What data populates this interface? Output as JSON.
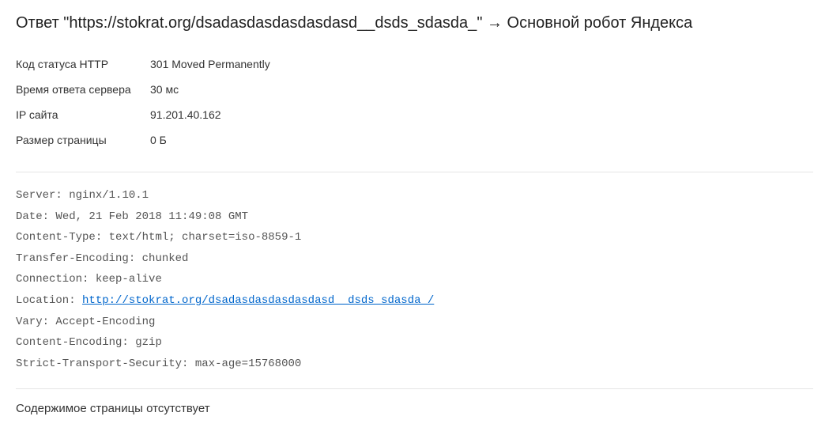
{
  "title": {
    "prefix": "Ответ \"",
    "url": "https://stokrat.org/dsadasdasdasdasdasd__dsds_sdasda_",
    "suffix": "\" → Основной робот Яндекса"
  },
  "info": {
    "rows": [
      {
        "label": "Код статуса HTTP",
        "value": "301 Moved Permanently"
      },
      {
        "label": "Время ответа сервера",
        "value": "30 мс"
      },
      {
        "label": "IP сайта",
        "value": "91.201.40.162"
      },
      {
        "label": "Размер страницы",
        "value": "0 Б"
      }
    ]
  },
  "headers": [
    {
      "name": "Server",
      "value": "nginx/1.10.1"
    },
    {
      "name": "Date",
      "value": "Wed, 21 Feb 2018 11:49:08 GMT"
    },
    {
      "name": "Content-Type",
      "value": "text/html; charset=iso-8859-1"
    },
    {
      "name": "Transfer-Encoding",
      "value": "chunked"
    },
    {
      "name": "Connection",
      "value": "keep-alive"
    },
    {
      "name": "Location",
      "value": "http://stokrat.org/dsadasdasdasdasdasd__dsds_sdasda_/",
      "is_link": true
    },
    {
      "name": "Vary",
      "value": "Accept-Encoding"
    },
    {
      "name": "Content-Encoding",
      "value": "gzip"
    },
    {
      "name": "Strict-Transport-Security",
      "value": "max-age=15768000"
    }
  ],
  "footer": "Содержимое страницы отсутствует"
}
